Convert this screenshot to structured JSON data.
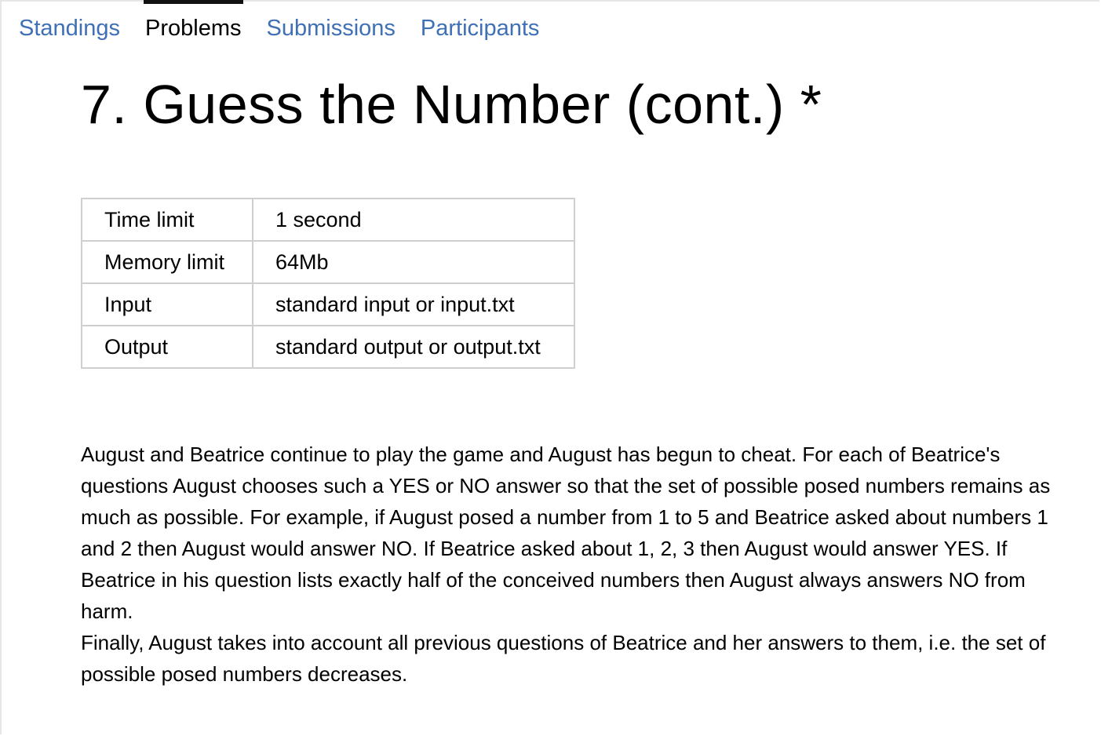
{
  "tabs": [
    {
      "label": "Standings",
      "active": false
    },
    {
      "label": "Problems",
      "active": true
    },
    {
      "label": "Submissions",
      "active": false
    },
    {
      "label": "Participants",
      "active": false
    }
  ],
  "problem": {
    "title": "7. Guess the Number (cont.) *",
    "limits": [
      {
        "label": "Time limit",
        "value": "1 second"
      },
      {
        "label": "Memory limit",
        "value": "64Mb"
      },
      {
        "label": "Input",
        "value": "standard input or input.txt"
      },
      {
        "label": "Output",
        "value": "standard output or output.txt"
      }
    ],
    "statement": [
      "August and Beatrice continue to play the game and August has begun to cheat. For each of Beatrice's questions August chooses such a YES or NO answer so that the set of possible posed numbers remains as much as possible. For example, if August posed a number from 1 to 5 and Beatrice asked about numbers 1 and 2 then August would answer NO. If Beatrice asked about 1, 2, 3 then August would answer YES. If Beatrice in his question lists exactly half of the conceived numbers then August always answers NO from harm.",
      "Finally, August takes into account all previous questions of Beatrice and her answers to them, i.e. the set of possible posed numbers decreases."
    ]
  }
}
